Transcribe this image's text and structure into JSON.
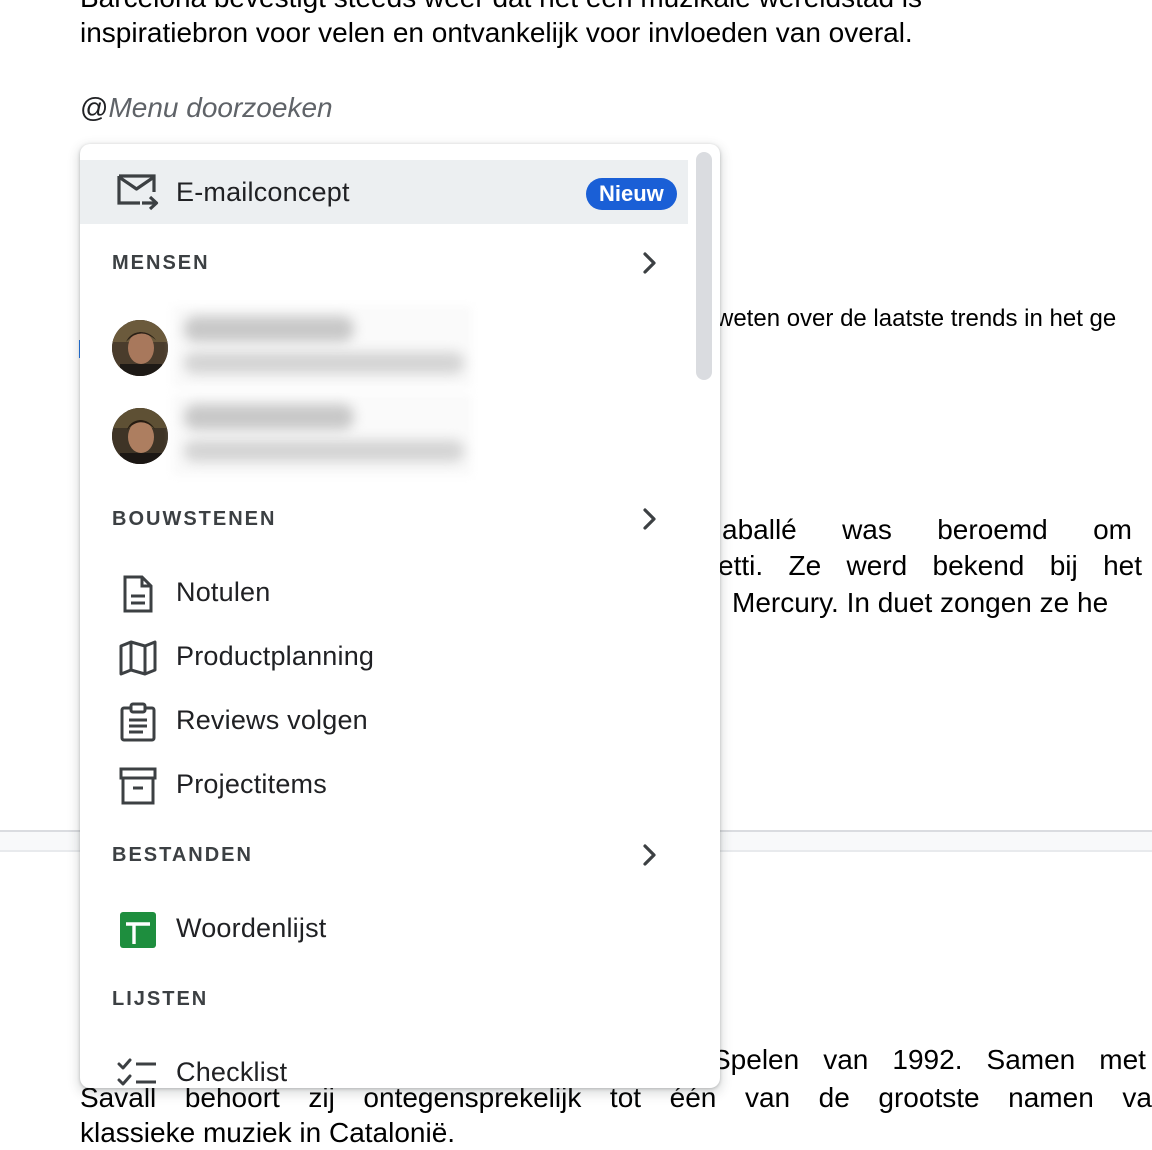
{
  "document": {
    "line_top_clipped": "Barcelona bevestigt steeds weer dat het een muzikale wereldstad is",
    "line_inspiratie": "inspiratiebron voor velen en ontvankelijk voor invloeden van overal.",
    "mention_at": "@",
    "mention_placeholder": "Menu doorzoeken",
    "line_weten": "weten over de laatste trends in het ge",
    "row1": [
      "aballé",
      "was",
      "beroemd",
      "om"
    ],
    "row2": [
      "etti.",
      "Ze",
      "werd",
      "bekend",
      "bij",
      "het"
    ],
    "line_mercury": "Mercury. In duet zongen ze he",
    "row_spelen": [
      "Spelen",
      "van",
      "1992.",
      "Samen",
      "met"
    ],
    "row_savall": [
      "Savall",
      "behoort",
      "zij",
      "ontegensprekelijk",
      "tot",
      "één",
      "van",
      "de",
      "grootste",
      "namen",
      "va"
    ],
    "line_clipped_bottom": "klassieke muziek in Catalonië."
  },
  "menu": {
    "email_draft": {
      "label": "E-mailconcept",
      "badge": "Nieuw",
      "icon": "email-draft-icon"
    },
    "sections": {
      "people": "MENSEN",
      "building_blocks": "BOUWSTENEN",
      "files": "BESTANDEN",
      "lists": "LIJSTEN"
    },
    "building_blocks": [
      {
        "label": "Notulen",
        "icon": "document-icon"
      },
      {
        "label": "Productplanning",
        "icon": "map-icon"
      },
      {
        "label": "Reviews volgen",
        "icon": "clipboard-icon"
      },
      {
        "label": "Projectitems",
        "icon": "archive-icon"
      }
    ],
    "files": [
      {
        "label": "Woordenlijst",
        "icon": "sheets-icon"
      }
    ],
    "lists": [
      {
        "label": "Checklist",
        "icon": "checklist-icon"
      }
    ]
  },
  "colors": {
    "accent": "#1a5fd6",
    "highlight": "#eceff1",
    "sheets_green": "#1e8e3e",
    "text": "#202124"
  }
}
